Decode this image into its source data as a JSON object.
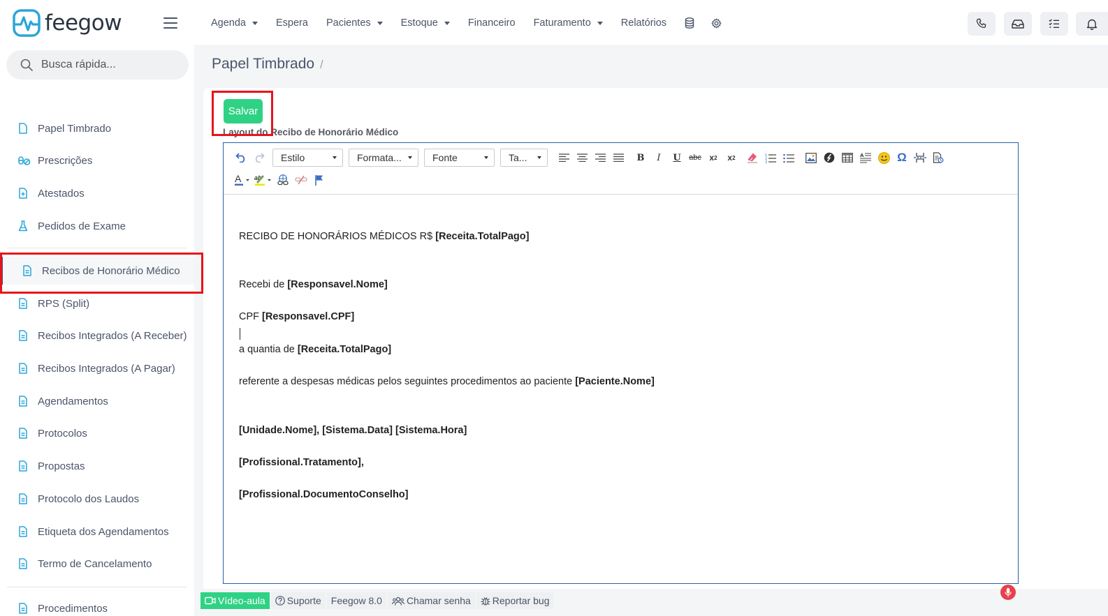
{
  "brand": {
    "name": "feegow",
    "color": "#2aa6d8"
  },
  "nav": {
    "items": [
      {
        "label": "Agenda",
        "dropdown": true
      },
      {
        "label": "Espera",
        "dropdown": false
      },
      {
        "label": "Pacientes",
        "dropdown": true
      },
      {
        "label": "Estoque",
        "dropdown": true
      },
      {
        "label": "Financeiro",
        "dropdown": false
      },
      {
        "label": "Faturamento",
        "dropdown": true
      },
      {
        "label": "Relatórios",
        "dropdown": false
      }
    ],
    "icons": [
      "database-icon",
      "gear-icon"
    ],
    "right_buttons": [
      "phone-icon",
      "inbox-icon",
      "checklist-icon",
      "bell-icon"
    ]
  },
  "sidebar": {
    "search_placeholder": "Busca rápida...",
    "items": [
      {
        "label": "Papel Timbrado",
        "icon": "file-icon"
      },
      {
        "label": "Prescrições",
        "icon": "pills-icon"
      },
      {
        "label": "Atestados",
        "icon": "file-plus-icon"
      },
      {
        "label": "Pedidos de Exame",
        "icon": "flask-icon"
      },
      {
        "label": "Recibos de Honorário Médico",
        "icon": "file-text-icon",
        "active": true
      },
      {
        "label": "RPS (Split)",
        "icon": "file-text-icon"
      },
      {
        "label": "Recibos Integrados (A Receber)",
        "icon": "file-text-icon"
      },
      {
        "label": "Recibos Integrados (A Pagar)",
        "icon": "file-text-icon"
      },
      {
        "label": "Agendamentos",
        "icon": "file-text-icon"
      },
      {
        "label": "Protocolos",
        "icon": "file-text-icon"
      },
      {
        "label": "Propostas",
        "icon": "file-text-icon"
      },
      {
        "label": "Protocolo dos Laudos",
        "icon": "file-text-icon"
      },
      {
        "label": "Etiqueta dos Agendamentos",
        "icon": "file-text-icon"
      },
      {
        "label": "Termo de Cancelamento",
        "icon": "file-text-icon"
      },
      {
        "label": "Procedimentos",
        "icon": "file-text-icon"
      }
    ]
  },
  "main": {
    "title": "Papel Timbrado",
    "breadcrumb_sep": "/",
    "save_label": "Salvar",
    "field_label": "Layout do Recibo de Honorário Médico",
    "toolbar": {
      "combos": [
        "Estilo",
        "Formata...",
        "Fonte",
        "Ta..."
      ]
    },
    "document": {
      "line1_text": "RECIBO DE HONORÁRIOS MÉDICOS R$ ",
      "line1_tag": "[Receita.TotalPago]",
      "line2_text": "Recebi de ",
      "line2_tag": "[Responsavel.Nome]",
      "line3_text": "CPF ",
      "line3_tag": "[Responsavel.CPF]",
      "line4_text": "a quantia de ",
      "line4_tag": "[Receita.TotalPago]",
      "line5_text": "referente a despesas médicas pelos seguintes procedimentos ao paciente ",
      "line5_tag": "[Paciente.Nome]",
      "line6_tag": "[Unidade.Nome], [Sistema.Data] [Sistema.Hora]",
      "line7_tag": "[Profissional.Tratamento],",
      "line8_tag": "[Profissional.DocumentoConselho]"
    }
  },
  "footer": {
    "video": "Vídeo-aula",
    "support": "Suporte",
    "version": "Feegow 8.0",
    "call": "Chamar senha",
    "bug": "Reportar bug"
  },
  "colors": {
    "accent_green": "#2fd284",
    "highlight_red": "#e8141b",
    "editor_border": "#2b5ea6",
    "file_icon_blue": "#2aa6d8"
  }
}
